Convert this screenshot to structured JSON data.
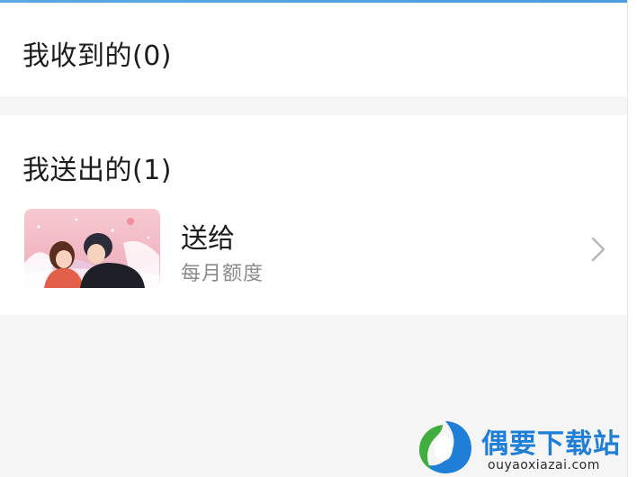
{
  "received": {
    "title": "我收到的(0)"
  },
  "sent": {
    "title": "我送出的(1)",
    "items": [
      {
        "title": "送给",
        "subtitle": "每月额度",
        "thumbnail": "couple-winter-illustration"
      }
    ]
  },
  "watermark": {
    "name": "偶要下载站",
    "url": "ouyaoxiazai.com"
  },
  "colors": {
    "accent": "#4a9de0",
    "background": "#f5f5f5",
    "card": "#ffffff",
    "subtext": "#8a8a8a"
  }
}
